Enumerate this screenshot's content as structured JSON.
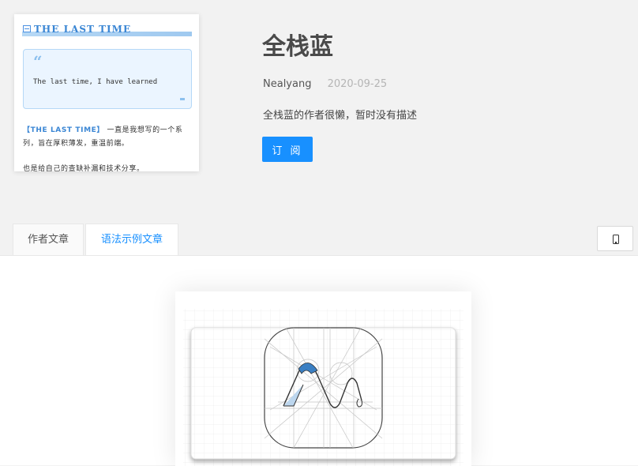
{
  "header": {
    "title": "全栈蓝",
    "author": "Nealyang",
    "date": "2020-09-25",
    "description": "全栈蓝的作者很懒，暂时没有描述",
    "subscribe_label": "订 阅"
  },
  "cover": {
    "title": "THE LAST TIME",
    "quote": "The last time, I have learned",
    "body_highlight": "【THE LAST TIME】",
    "body_line1": "一直是我想写的一个系列，旨在厚积薄发，重温前端。",
    "body_line2": "也是给自己的查缺补漏和技术分享。"
  },
  "tabs": [
    {
      "label": "作者文章",
      "active": false
    },
    {
      "label": "语法示例文章",
      "active": true
    }
  ],
  "toolbar": {
    "device_icon": "mobile-phone-icon"
  },
  "colors": {
    "accent": "#1890ff",
    "background": "#f2f2f2",
    "cover_accent": "#3a86d4"
  }
}
